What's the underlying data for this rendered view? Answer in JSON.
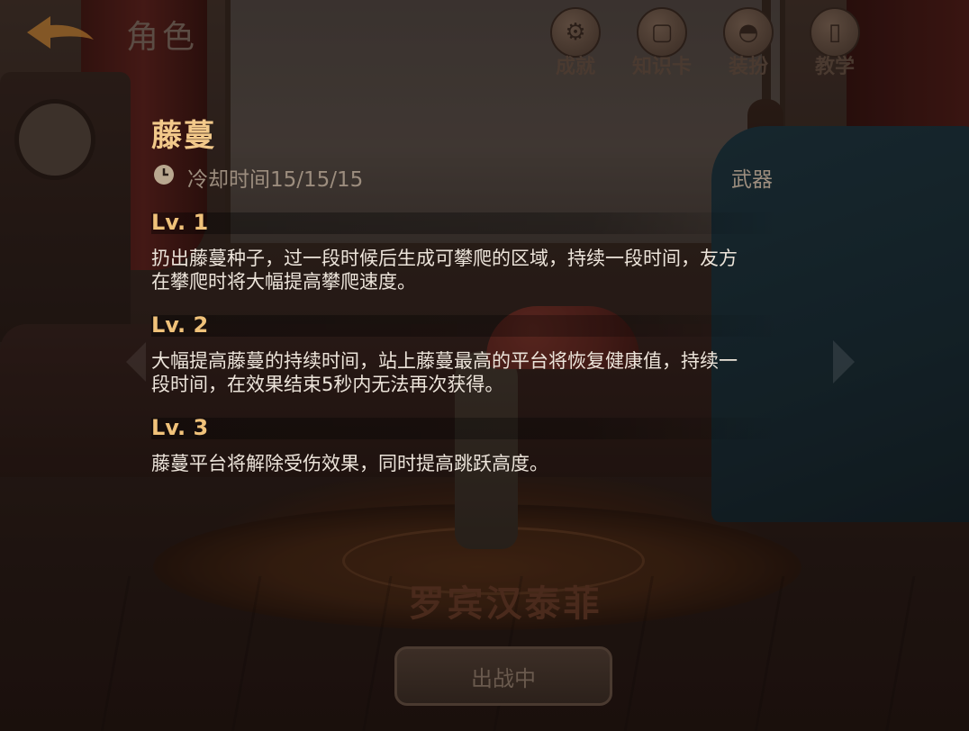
{
  "header": {
    "back_icon": "back-arrow-icon",
    "title": "角色",
    "accent_color": "#e8a33c"
  },
  "top_nav": [
    {
      "label": "成就",
      "icon": "gear-icon"
    },
    {
      "label": "知识卡",
      "icon": "card-icon"
    },
    {
      "label": "装扮",
      "icon": "outfit-icon"
    },
    {
      "label": "教学",
      "icon": "book-icon"
    }
  ],
  "skill": {
    "name": "藤蔓",
    "cooldown": "冷却时间15/15/15",
    "category": "武器",
    "levels": [
      {
        "title": "Lv. 1",
        "desc": "扔出藤蔓种子，过一段时候后生成可攀爬的区域，持续一段时间，友方在攀爬时将大幅提高攀爬速度。"
      },
      {
        "title": "Lv. 2",
        "desc": "大幅提高藤蔓的持续时间，站上藤蔓最高的平台将恢复健康值，持续一段时间，在效果结束5秒内无法再次获得。"
      },
      {
        "title": "Lv. 3",
        "desc": "藤蔓平台将解除受伤效果，同时提高跳跃高度。"
      }
    ]
  },
  "character": {
    "name": "罗宾汉泰菲",
    "button_label": "出战中"
  },
  "colors": {
    "skill_name": "#f2c98a",
    "level_title": "#f0c27a",
    "desc_text": "#ece4da",
    "meta_text": "#9c8d7e"
  }
}
